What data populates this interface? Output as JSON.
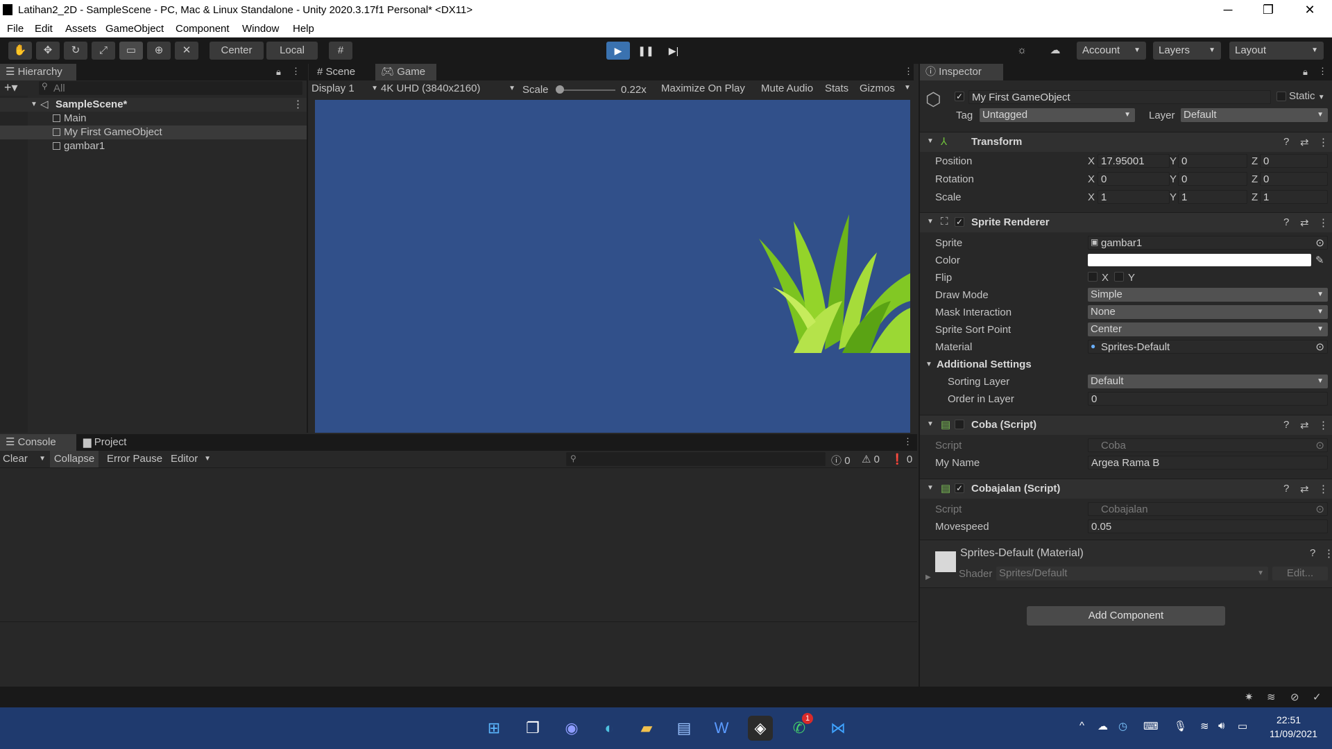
{
  "window": {
    "title": "Latihan2_2D - SampleScene - PC, Mac & Linux Standalone - Unity 2020.3.17f1 Personal* <DX11>",
    "minimize": "─",
    "restore": "❐",
    "close": "✕"
  },
  "menu": [
    "File",
    "Edit",
    "Assets",
    "GameObject",
    "Component",
    "Window",
    "Help"
  ],
  "toolbar": {
    "pivot": "Center",
    "space": "Local",
    "account": "Account",
    "layers": "Layers",
    "layout": "Layout",
    "play_icon": "▶",
    "pause_icon": "❚❚",
    "step_icon": "▶|"
  },
  "hierarchy": {
    "tab": "Hierarchy",
    "search_placeholder": "All",
    "scene": "SampleScene*",
    "items": [
      "Main",
      "My First GameObject",
      "gambar1"
    ]
  },
  "game": {
    "tab_scene": "Scene",
    "tab_game": "Game",
    "display": "Display 1",
    "resolution": "4K UHD (3840x2160)",
    "scale_label": "Scale",
    "scale_value": "0.22x",
    "maximize": "Maximize On Play",
    "mute": "Mute Audio",
    "stats": "Stats",
    "gizmos": "Gizmos",
    "background_color": "#31508a"
  },
  "console": {
    "tab": "Console",
    "project_tab": "Project",
    "clear": "Clear",
    "collapse": "Collapse",
    "error_pause": "Error Pause",
    "editor": "Editor",
    "log_count": "0",
    "warn_count": "0",
    "error_count": "0"
  },
  "inspector": {
    "tab": "Inspector",
    "object_name": "My First GameObject",
    "static": "Static",
    "tag_label": "Tag",
    "tag": "Untagged",
    "layer_label": "Layer",
    "layer": "Default",
    "transform": {
      "title": "Transform",
      "position_label": "Position",
      "position": {
        "x": "17.95001",
        "y": "0",
        "z": "0"
      },
      "rotation_label": "Rotation",
      "rotation": {
        "x": "0",
        "y": "0",
        "z": "0"
      },
      "scale_label": "Scale",
      "scale": {
        "x": "1",
        "y": "1",
        "z": "1"
      }
    },
    "sprite_renderer": {
      "title": "Sprite Renderer",
      "sprite_label": "Sprite",
      "sprite": "gambar1",
      "color_label": "Color",
      "flip_label": "Flip",
      "flip_x": "X",
      "flip_y": "Y",
      "draw_mode_label": "Draw Mode",
      "draw_mode": "Simple",
      "mask_label": "Mask Interaction",
      "mask": "None",
      "sort_point_label": "Sprite Sort Point",
      "sort_point": "Center",
      "material_label": "Material",
      "material": "Sprites-Default",
      "additional": "Additional Settings",
      "sorting_layer_label": "Sorting Layer",
      "sorting_layer": "Default",
      "order_label": "Order in Layer",
      "order": "0"
    },
    "coba": {
      "title": "Coba (Script)",
      "script_label": "Script",
      "script": "Coba",
      "myname_label": "My Name",
      "myname": "Argea Rama B"
    },
    "cobajalan": {
      "title": "Cobajalan (Script)",
      "script_label": "Script",
      "script": "Cobajalan",
      "movespeed_label": "Movespeed",
      "movespeed": "0.05"
    },
    "material": {
      "title": "Sprites-Default (Material)",
      "shader_label": "Shader",
      "shader": "Sprites/Default",
      "edit": "Edit..."
    },
    "add_component": "Add Component"
  },
  "taskbar": {
    "time": "22:51",
    "date": "11/09/2021",
    "whatsapp_badge": "1"
  }
}
